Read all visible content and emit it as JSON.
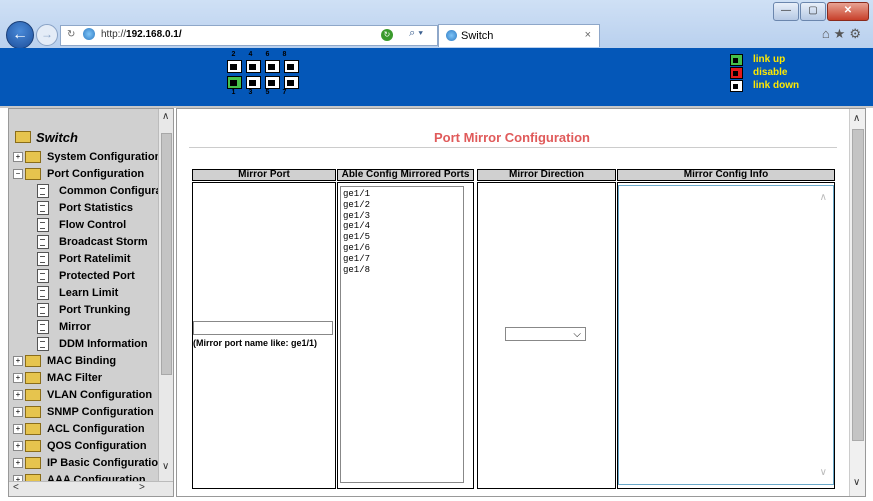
{
  "browser": {
    "url_prefix": "http://",
    "url_host": "192.168.0.1/",
    "tab_title": "Switch",
    "tab_close": "×",
    "back": "←",
    "forward": "→",
    "search_glyph": "⌕ ▾",
    "tools": "⌂★⚙",
    "win_min": "—",
    "win_max": "▢",
    "win_close": "✕"
  },
  "banner": {
    "port_top_numbers": [
      "2",
      "4",
      "6",
      "8"
    ],
    "port_bottom_numbers": [
      "1",
      "3",
      "5",
      "7"
    ],
    "port_top_states": [
      "disabled",
      "disabled",
      "disabled",
      "disabled"
    ],
    "port_bottom_states": [
      "up",
      "disabled",
      "disabled",
      "disabled"
    ],
    "legend": [
      {
        "label": "link up",
        "color": "#46c14a"
      },
      {
        "label": "disable",
        "color": "#e21b1b"
      },
      {
        "label": "link down",
        "color": "#ffffff"
      }
    ]
  },
  "sidebar": {
    "root": "Switch",
    "items": [
      {
        "label": "System Configuration",
        "type": "folder",
        "expander": "+"
      },
      {
        "label": "Port Configuration",
        "type": "folder-open",
        "expander": "−"
      },
      {
        "label": "Common Configuratio",
        "type": "doc"
      },
      {
        "label": "Port Statistics",
        "type": "doc"
      },
      {
        "label": "Flow Control",
        "type": "doc"
      },
      {
        "label": "Broadcast Storm",
        "type": "doc"
      },
      {
        "label": "Port Ratelimit",
        "type": "doc"
      },
      {
        "label": "Protected Port",
        "type": "doc"
      },
      {
        "label": "Learn Limit",
        "type": "doc"
      },
      {
        "label": "Port Trunking",
        "type": "doc"
      },
      {
        "label": "Mirror",
        "type": "doc"
      },
      {
        "label": "DDM Information",
        "type": "doc"
      },
      {
        "label": "MAC Binding",
        "type": "folder",
        "expander": "+"
      },
      {
        "label": "MAC Filter",
        "type": "folder",
        "expander": "+"
      },
      {
        "label": "VLAN Configuration",
        "type": "folder",
        "expander": "+"
      },
      {
        "label": "SNMP Configuration",
        "type": "folder",
        "expander": "+"
      },
      {
        "label": "ACL Configuration",
        "type": "folder",
        "expander": "+"
      },
      {
        "label": "QOS Configuration",
        "type": "folder",
        "expander": "+"
      },
      {
        "label": "IP Basic Configuration",
        "type": "folder",
        "expander": "+"
      },
      {
        "label": "AAA Configuration",
        "type": "folder",
        "expander": "+"
      }
    ]
  },
  "main": {
    "title": "Port Mirror Configuration",
    "columns": [
      "Mirror Port",
      "Able Config Mirrored Ports",
      "Mirror Direction",
      "Mirror Config Info"
    ],
    "ports": [
      "ge1/1",
      "ge1/2",
      "ge1/3",
      "ge1/4",
      "ge1/5",
      "ge1/6",
      "ge1/7",
      "ge1/8"
    ],
    "mirror_port_value": "",
    "mirror_port_hint": "(Mirror port name like: ge1/1)",
    "direction_value": "",
    "info_value": ""
  },
  "colors": {
    "banner": "#0457b8",
    "legend_text": "#ffea00",
    "title": "#e05a5a",
    "sidebar_bg": "#d0d0d0",
    "column_header_bg": "#d0d0d0"
  }
}
